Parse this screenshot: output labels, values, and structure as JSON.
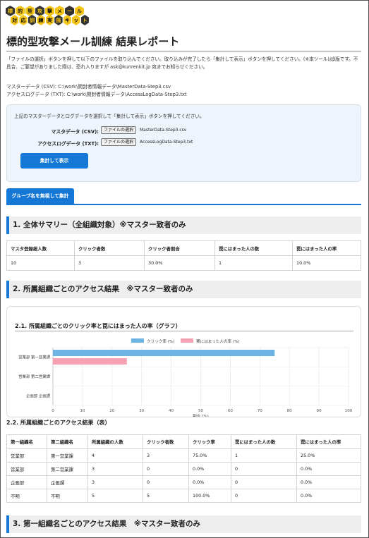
{
  "logo": {
    "row1": [
      "標",
      "的",
      "型",
      "攻",
      "撃",
      "メ",
      "ー",
      "ル"
    ],
    "row2": [
      "対",
      "応",
      "訓",
      "練",
      "実",
      "施",
      "キ",
      "ッ",
      "ト"
    ]
  },
  "page_title": "標的型攻撃メール訓練 結果レポート",
  "intro_text": "「ファイルの選択」ボタンを押して以下のファイルを取り込んでください。取り込みが完了したら「集計して表示」ボタンを押してください。(※本ツールはβ版です。不具合、ご要望がありました際は、恐れ入りますが ask@kunrenkit.jp 宛までお知らせください。",
  "paths": {
    "master": "マスターデータ (CSV): C:\\work\\開封者情報データ\\MasterData-Step3.csv",
    "access": "アクセスログデータ (TXT): C:\\work\\開封者情報データ\\AccessLogData-Step3.txt"
  },
  "upload": {
    "hint": "上記のマスターデータとログデータを選択して「集計して表示」ボタンを押してください。",
    "master_label": "マスタデータ (CSV):",
    "access_label": "アクセスログデータ (TXT):",
    "choose_label": "ファイルの選択",
    "master_file": "MasterData-Step3.csv",
    "access_file": "AccessLogData-Step3.txt",
    "tally_label": "集計して表示"
  },
  "tab_label": "グループ名を無視して集計",
  "section1": {
    "heading": "1. 全体サマリー（全組織対象）※マスター致者のみ",
    "columns": [
      "マスタ登録総人数",
      "クリック者数",
      "クリック者割合",
      "罠にはまった人の数",
      "罠にはまった人の率"
    ],
    "row": [
      "10",
      "3",
      "30.0%",
      "1",
      "10.0%"
    ]
  },
  "section2": {
    "heading": "2. 所属組織ごとのアクセス結果　※マスター致者のみ",
    "chart_heading": "2.1. 所属組織ごとのクリック率と罠にはまった人の率（グラフ）",
    "table_heading": "2.2. 所属組織ごとのアクセス結果（表）",
    "columns": [
      "第一組織名",
      "第二組織名",
      "所属組織の人数",
      "クリック者数",
      "クリック率",
      "罠にはまった人の数",
      "罠にはまった人の率"
    ],
    "rows": [
      [
        "営業部",
        "第一営業課",
        "4",
        "3",
        "75.0%",
        "1",
        "25.0%"
      ],
      [
        "営業部",
        "第二営業課",
        "3",
        "0",
        "0.0%",
        "0",
        "0.0%"
      ],
      [
        "企画部",
        "企画課",
        "3",
        "0",
        "0.0%",
        "0",
        "0.0%"
      ],
      [
        "不明",
        "不明",
        "5",
        "5",
        "100.0%",
        "0",
        "0.0%"
      ]
    ]
  },
  "section3": {
    "heading": "3. 第一組織名ごとのアクセス結果　※マスター致者のみ"
  },
  "chart_data": {
    "type": "bar",
    "orientation": "horizontal",
    "categories": [
      "営業部 第一営業課",
      "営業部 第二営業課",
      "企画部 企画課"
    ],
    "series": [
      {
        "name": "クリック率 (%)",
        "values": [
          75,
          0,
          0
        ],
        "color": "#6cb4e4"
      },
      {
        "name": "罠にはまった人の率 (%)",
        "values": [
          25,
          0,
          0
        ],
        "color": "#f7a1b5"
      }
    ],
    "xlabel": "割合 (%)",
    "xlim": [
      0,
      100
    ],
    "xticks": [
      0,
      10,
      20,
      30,
      40,
      50,
      60,
      70,
      80,
      90,
      100
    ],
    "legend_position": "top-center",
    "grid": true
  },
  "colors": {
    "accent": "#1578d6",
    "click_series": "#6cb4e4",
    "trap_series": "#f7a1b5"
  }
}
